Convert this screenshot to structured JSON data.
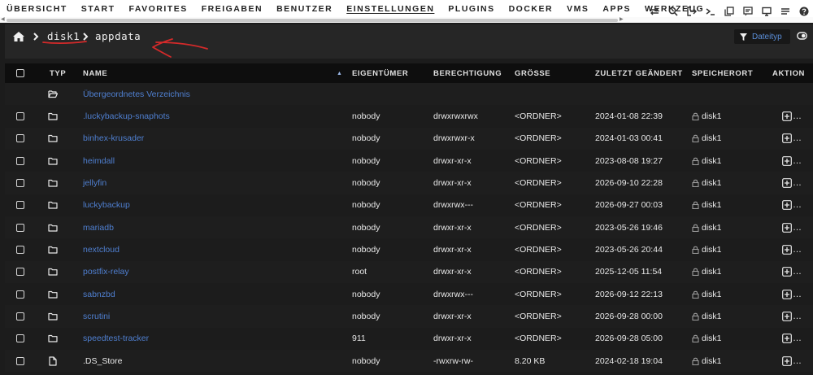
{
  "nav": {
    "items": [
      "ÜBERSICHT",
      "START",
      "FAVORITES",
      "FREIGABEN",
      "BENUTZER",
      "EINSTELLUNGEN",
      "PLUGINS",
      "DOCKER",
      "VMS",
      "APPS",
      "WERKZEUG"
    ],
    "active_index": 5,
    "icons": [
      "switch-icon",
      "search-icon",
      "logout-icon",
      "terminal-icon",
      "copy-icon",
      "notes-icon",
      "monitor-icon",
      "menu-icon",
      "help-icon"
    ]
  },
  "breadcrumb": {
    "items": [
      "disk1",
      "appdata"
    ],
    "annotation": "red hand-drawn arrow pointing to path"
  },
  "filter": {
    "label": "Dateityp"
  },
  "table": {
    "columns": [
      "TYP",
      "NAME",
      "EIGENTÜMER",
      "BERECHTIGUNG",
      "GRÖSSE",
      "ZULETZT GEÄNDERT",
      "SPEICHERORT",
      "AKTION"
    ],
    "parent_label": "Übergeordnetes Verzeichnis",
    "rows": [
      {
        "type": "folder",
        "name": ".luckybackup-snaphots",
        "owner": "nobody",
        "perm": "drwxrwxrwx",
        "size": "<ORDNER>",
        "modified": "2024-01-08 22:39",
        "location": "disk1"
      },
      {
        "type": "folder",
        "name": "binhex-krusader",
        "owner": "nobody",
        "perm": "drwxrwxr-x",
        "size": "<ORDNER>",
        "modified": "2024-01-03 00:41",
        "location": "disk1"
      },
      {
        "type": "folder",
        "name": "heimdall",
        "owner": "nobody",
        "perm": "drwxr-xr-x",
        "size": "<ORDNER>",
        "modified": "2023-08-08 19:27",
        "location": "disk1"
      },
      {
        "type": "folder",
        "name": "jellyfin",
        "owner": "nobody",
        "perm": "drwxr-xr-x",
        "size": "<ORDNER>",
        "modified": "2026-09-10 22:28",
        "location": "disk1"
      },
      {
        "type": "folder",
        "name": "luckybackup",
        "owner": "nobody",
        "perm": "drwxrwx---",
        "size": "<ORDNER>",
        "modified": "2026-09-27 00:03",
        "location": "disk1"
      },
      {
        "type": "folder",
        "name": "mariadb",
        "owner": "nobody",
        "perm": "drwxr-xr-x",
        "size": "<ORDNER>",
        "modified": "2023-05-26 19:46",
        "location": "disk1"
      },
      {
        "type": "folder",
        "name": "nextcloud",
        "owner": "nobody",
        "perm": "drwxr-xr-x",
        "size": "<ORDNER>",
        "modified": "2023-05-26 20:44",
        "location": "disk1"
      },
      {
        "type": "folder",
        "name": "postfix-relay",
        "owner": "root",
        "perm": "drwxr-xr-x",
        "size": "<ORDNER>",
        "modified": "2025-12-05 11:54",
        "location": "disk1"
      },
      {
        "type": "folder",
        "name": "sabnzbd",
        "owner": "nobody",
        "perm": "drwxrwx---",
        "size": "<ORDNER>",
        "modified": "2026-09-12 22:13",
        "location": "disk1"
      },
      {
        "type": "folder",
        "name": "scrutini",
        "owner": "nobody",
        "perm": "drwxr-xr-x",
        "size": "<ORDNER>",
        "modified": "2026-09-28 00:00",
        "location": "disk1"
      },
      {
        "type": "folder",
        "name": "speedtest-tracker",
        "owner": "911",
        "perm": "drwxr-xr-x",
        "size": "<ORDNER>",
        "modified": "2026-09-28 05:00",
        "location": "disk1"
      },
      {
        "type": "file",
        "name": ".DS_Store",
        "owner": "nobody",
        "perm": "-rwxrw-rw-",
        "size": "8.20 KB",
        "modified": "2024-02-18 19:04",
        "location": "disk1"
      }
    ]
  },
  "colors": {
    "link": "#4f7fd0",
    "background": "#1c1c1c",
    "row_alt": "#1e1e1e",
    "header": "#0e0e0e",
    "annotation": "#d42a2a"
  }
}
